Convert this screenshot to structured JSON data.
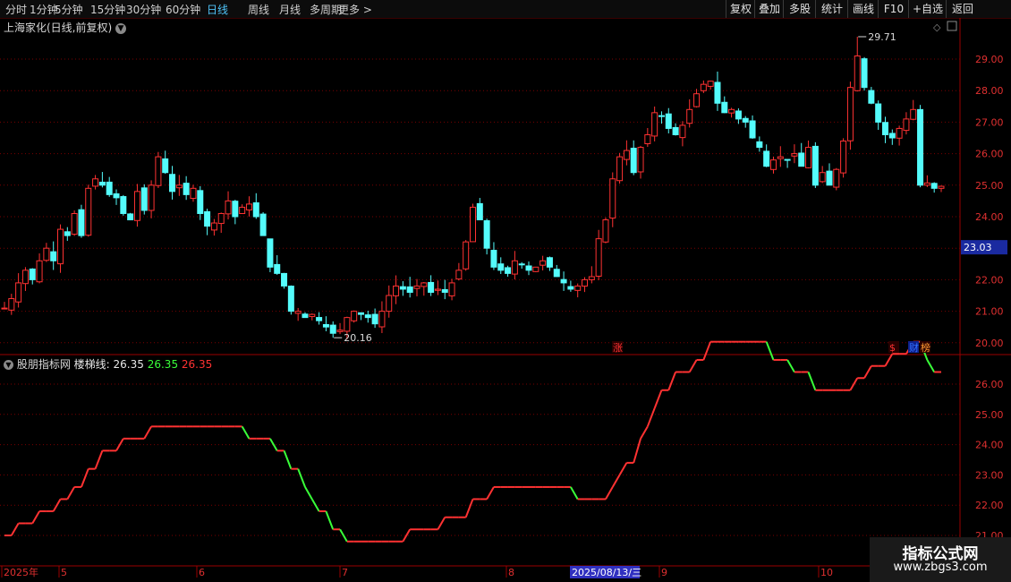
{
  "toolbar": {
    "periods": [
      "分时",
      "1分钟",
      "5分钟",
      "15分钟",
      "30分钟",
      "60分钟",
      "日线",
      "周线",
      "月线",
      "多周期",
      "更多 >"
    ],
    "active_period": "日线",
    "right_buttons": [
      "复权",
      "叠加",
      "多股",
      "统计",
      "画线",
      "F10",
      "+自选",
      "返回"
    ]
  },
  "main": {
    "title": "上海家化(日线,前复权)",
    "high_label": "29.71",
    "low_label": "20.16",
    "current_price": "23.03",
    "event_markers": [
      "涨",
      "$",
      "财",
      "榜"
    ],
    "price_ticks": [
      "29.00",
      "28.00",
      "27.00",
      "26.00",
      "25.00",
      "24.00",
      "23.00",
      "22.00",
      "21.00",
      "20.00"
    ]
  },
  "indicator": {
    "name": "股朋指标网",
    "line_label": "楼梯线: 26.35",
    "value_green": "26.35",
    "value_red": "26.35",
    "ticks": [
      "26.00",
      "25.00",
      "24.00",
      "23.00",
      "22.00",
      "21.00"
    ]
  },
  "x_axis": {
    "labels": [
      "2025年",
      "5",
      "6",
      "7",
      "8",
      "9",
      "10"
    ],
    "cursor_date": "2025/08/13/三"
  },
  "watermark": {
    "line1": "指标公式网",
    "line2": "www.zbgs3.com"
  },
  "colors": {
    "up": "#ff3232",
    "down": "#54fcfc",
    "grid": "#7a0000",
    "cursor": "#3030c0"
  },
  "chart_data": {
    "type": "candlestick",
    "title": "上海家化(日线,前复权)",
    "ylim": [
      19.8,
      29.9
    ],
    "y_ticks": [
      20,
      21,
      22,
      23,
      24,
      25,
      26,
      27,
      28,
      29
    ],
    "x_labels": [
      "2025年",
      "5",
      "6",
      "7",
      "8",
      "9",
      "10"
    ],
    "max_label": 29.71,
    "min_label": 20.16,
    "last_price": 23.03,
    "closes": [
      21.1,
      21.4,
      21.9,
      22.3,
      22.0,
      22.6,
      23.0,
      22.6,
      23.6,
      23.4,
      24.1,
      23.4,
      24.9,
      25.2,
      25.0,
      24.7,
      24.6,
      24.1,
      23.9,
      24.8,
      24.2,
      25.0,
      25.9,
      25.4,
      24.8,
      25.0,
      24.7,
      24.9,
      24.1,
      23.7,
      23.8,
      24.1,
      24.5,
      24.0,
      24.3,
      24.4,
      24.0,
      23.4,
      22.4,
      22.2,
      21.8,
      21.0,
      21.0,
      20.8,
      20.9,
      20.7,
      20.5,
      20.3,
      20.4,
      20.8,
      21.0,
      20.9,
      20.8,
      20.6,
      21.0,
      21.5,
      21.8,
      21.7,
      21.6,
      21.8,
      21.9,
      21.6,
      21.7,
      21.6,
      21.9,
      22.3,
      23.2,
      24.3,
      23.9,
      23.0,
      22.4,
      22.3,
      22.2,
      22.6,
      22.5,
      22.3,
      22.4,
      22.6,
      22.4,
      22.1,
      21.9,
      21.7,
      21.8,
      22.0,
      22.0,
      23.3,
      23.9,
      25.2,
      25.9,
      26.1,
      25.4,
      26.2,
      26.6,
      27.3,
      27.2,
      26.8,
      26.6,
      26.9,
      27.4,
      27.9,
      28.2,
      28.3,
      27.6,
      27.3,
      27.4,
      27.1,
      27.0,
      26.5,
      26.2,
      25.6,
      25.8,
      25.9,
      25.8,
      26.0,
      25.6,
      26.2,
      25.0,
      25.4,
      25.0,
      25.5,
      26.4,
      28.1,
      29.1,
      28.1,
      27.6,
      27.0,
      26.6,
      26.5,
      26.8,
      27.1,
      27.4,
      25.0,
      25.0,
      24.9,
      24.9
    ]
  }
}
